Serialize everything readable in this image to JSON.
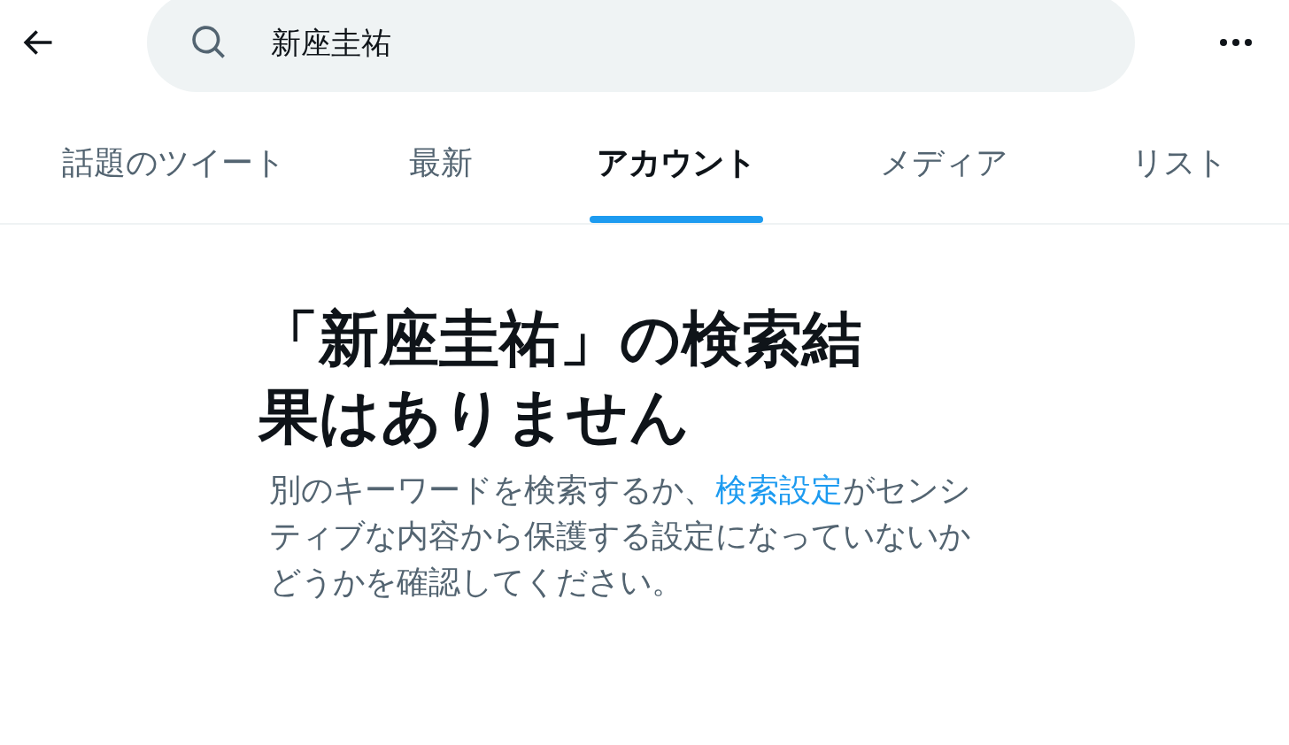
{
  "search": {
    "value": "新座圭祐"
  },
  "tabs": [
    {
      "label": "話題のツイート",
      "selected": false
    },
    {
      "label": "最新",
      "selected": false
    },
    {
      "label": "アカウント",
      "selected": true
    },
    {
      "label": "メディア",
      "selected": false
    },
    {
      "label": "リスト",
      "selected": false
    }
  ],
  "empty_state": {
    "title": "「新座圭祐」の検索結果はありません",
    "message_before": "別のキーワードを検索するか、",
    "link": "検索設定",
    "message_after": "がセンシティブな内容から保護する設定になっていないかどうかを確認してください。"
  }
}
